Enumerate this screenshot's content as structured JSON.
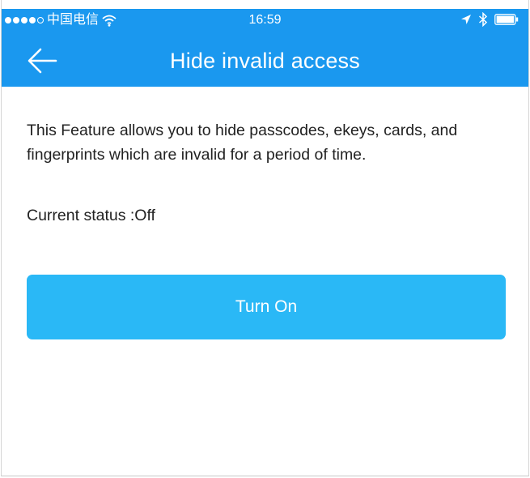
{
  "status_bar": {
    "carrier": "中国电信",
    "time": "16:59",
    "signal_icon": "signal-dots-icon",
    "wifi_icon": "wifi-icon",
    "location_icon": "location-arrow-icon",
    "bluetooth_icon": "bluetooth-icon",
    "battery_icon": "battery-icon"
  },
  "nav": {
    "back_icon": "back-arrow-icon",
    "title": "Hide invalid access"
  },
  "content": {
    "description": "This Feature allows you to hide passcodes, ekeys, cards, and fingerprints which are invalid for a period of time.",
    "status_label": "Current status :Off"
  },
  "actions": {
    "turn_on_label": "Turn On"
  },
  "colors": {
    "header_blue": "#1a98ef",
    "button_blue": "#2ab8f6",
    "text": "#222222"
  }
}
